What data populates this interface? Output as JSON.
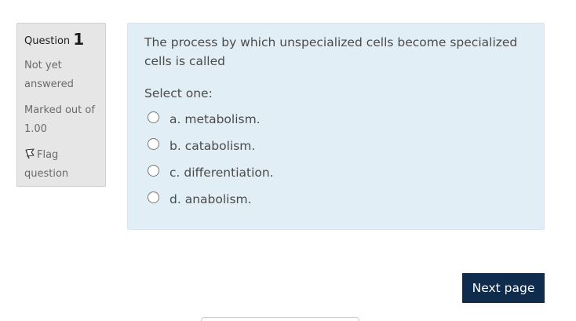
{
  "info": {
    "question_label": "Question",
    "question_number": "1",
    "state": "Not yet answered",
    "grade": "Marked out of 1.00",
    "flag_label": "Flag question",
    "flag_icon": "flag-icon"
  },
  "question": {
    "text": "The process by which unspecialized cells become specialized cells is called",
    "prompt": "Select one:",
    "answers": [
      {
        "label": "a. metabolism.",
        "selected": false
      },
      {
        "label": "b. catabolism.",
        "selected": false
      },
      {
        "label": "c. differentiation.",
        "selected": false
      },
      {
        "label": "d. anabolism.",
        "selected": false
      }
    ]
  },
  "navigation": {
    "next_label": "Next page"
  },
  "colors": {
    "info_bg": "#e6e6e6",
    "question_bg": "#e1eef5",
    "button_bg": "#0f2c4d"
  }
}
